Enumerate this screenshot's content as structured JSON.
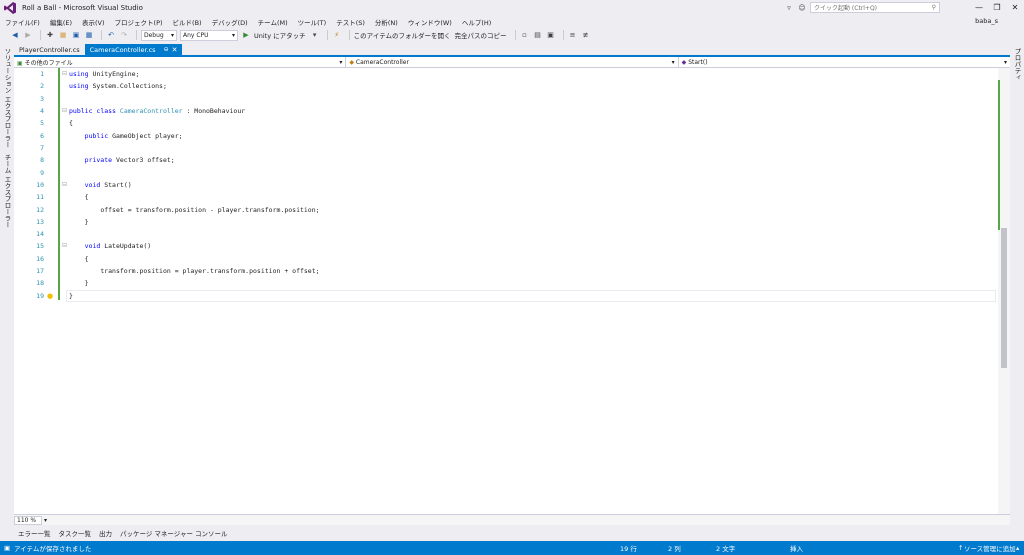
{
  "window": {
    "title": "Roll a Ball - Microsoft Visual Studio",
    "quick_launch_placeholder": "クイック起動 (Ctrl+Q)",
    "user": "baba_s",
    "minimize": "—",
    "restore": "❐",
    "close": "✕"
  },
  "menu": [
    "ファイル(F)",
    "編集(E)",
    "表示(V)",
    "プロジェクト(P)",
    "ビルド(B)",
    "デバッグ(D)",
    "チーム(M)",
    "ツール(T)",
    "テスト(S)",
    "分析(N)",
    "ウィンドウ(W)",
    "ヘルプ(H)"
  ],
  "toolbar": {
    "config": "Debug",
    "platform": "Any CPU",
    "attach": "Unity にアタッチ",
    "open_folder": "このアイテムのフォルダーを開く",
    "copy_path": "完全パスのコピー"
  },
  "left_panel": {
    "solution_explorer": "ソリューション エクスプローラー",
    "team_explorer": "チーム エクスプローラー"
  },
  "right_panel": {
    "properties": "プロパティ"
  },
  "tabs": [
    {
      "label": "PlayerController.cs"
    },
    {
      "label": "CameraController.cs",
      "pin": "⊖",
      "close": "✕"
    }
  ],
  "navbar": {
    "project": "その他のファイル",
    "class": "CameraController",
    "member": "Start()"
  },
  "editor": {
    "lines": [
      {
        "n": "1",
        "t": "using UnityEngine;"
      },
      {
        "n": "2",
        "t": "using System.Collections;"
      },
      {
        "n": "3",
        "t": ""
      },
      {
        "n": "4",
        "t": "public class CameraController : MonoBehaviour"
      },
      {
        "n": "5",
        "t": "{"
      },
      {
        "n": "6",
        "t": "    public GameObject player;"
      },
      {
        "n": "7",
        "t": ""
      },
      {
        "n": "8",
        "t": "    private Vector3 offset;"
      },
      {
        "n": "9",
        "t": ""
      },
      {
        "n": "10",
        "t": "    void Start()"
      },
      {
        "n": "11",
        "t": "    {"
      },
      {
        "n": "12",
        "t": "        offset = transform.position - player.transform.position;"
      },
      {
        "n": "13",
        "t": "    }"
      },
      {
        "n": "14",
        "t": ""
      },
      {
        "n": "15",
        "t": "    void LateUpdate()"
      },
      {
        "n": "16",
        "t": "    {"
      },
      {
        "n": "17",
        "t": "        transform.position = player.transform.position + offset;"
      },
      {
        "n": "18",
        "t": "    }"
      },
      {
        "n": "19",
        "t": "}"
      }
    ]
  },
  "zoom": "110 %",
  "bottom_tabs": [
    "エラー一覧",
    "タスク一覧",
    "出力",
    "パッケージ マネージャー コンソール"
  ],
  "status": {
    "message": "アイテムが保存されました",
    "line": "19 行",
    "col": "2 列",
    "ch": "2 文字",
    "mode": "挿入",
    "source_control": "ソース管理に追加"
  },
  "colors": {
    "accent": "#007acc",
    "keyword": "#0000ff",
    "type": "#2b91af",
    "change_bar": "#57a64a"
  }
}
